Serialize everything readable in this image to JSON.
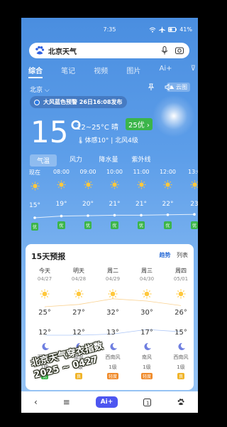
{
  "status": {
    "time": "7:35",
    "battery": "41%"
  },
  "search": {
    "query": "北京天气"
  },
  "tabs": [
    {
      "label": "综合",
      "active": true
    },
    {
      "label": "笔记"
    },
    {
      "label": "视频"
    },
    {
      "label": "图片"
    },
    {
      "label": "Ai+"
    },
    {
      "label": ""
    }
  ],
  "city": {
    "name": "北京",
    "cloud_label": "云图"
  },
  "alert": {
    "text": "大风蓝色预警 26日16:08发布"
  },
  "current": {
    "temp": "15°",
    "range": "12~25°C 晴",
    "aqi": "25优",
    "feel": "体感10° | 北风4级"
  },
  "subtabs": [
    "气温",
    "风力",
    "降水量",
    "紫外线"
  ],
  "hourly": [
    {
      "time": "现在",
      "temp": "15°",
      "q": "优",
      "v": 15
    },
    {
      "time": "08:00",
      "temp": "19°",
      "q": "优",
      "v": 19
    },
    {
      "time": "09:00",
      "temp": "20°",
      "q": "优",
      "v": 20
    },
    {
      "time": "10:00",
      "temp": "21°",
      "q": "优",
      "v": 21
    },
    {
      "time": "11:00",
      "temp": "21°",
      "q": "优",
      "v": 21
    },
    {
      "time": "12:00",
      "temp": "22°",
      "q": "优",
      "v": 22
    },
    {
      "time": "13:0",
      "temp": "23",
      "q": "优",
      "v": 23
    }
  ],
  "forecast": {
    "title": "15天预报",
    "toggle_trend": "趋势",
    "toggle_list": "列表",
    "days": [
      {
        "day": "今天",
        "date": "04/27",
        "hi": "25°",
        "lo": "12°",
        "wind": "西南风",
        "level": "1级",
        "q": "优",
        "qcolor": "#3bb54a",
        "hi_v": 25,
        "lo_v": 12
      },
      {
        "day": "明天",
        "date": "04/28",
        "hi": "27°",
        "lo": "12°",
        "wind": "南风",
        "level": "1级",
        "q": "良",
        "qcolor": "#f0b429",
        "hi_v": 27,
        "lo_v": 12
      },
      {
        "day": "周二",
        "date": "04/29",
        "hi": "32°",
        "lo": "13°",
        "wind": "西南风",
        "level": "1级",
        "q": "轻度",
        "qcolor": "#f08a29",
        "hi_v": 32,
        "lo_v": 13
      },
      {
        "day": "周三",
        "date": "04/30",
        "hi": "30°",
        "lo": "17°",
        "wind": "南风",
        "level": "1级",
        "q": "轻度",
        "qcolor": "#f08a29",
        "hi_v": 30,
        "lo_v": 17
      },
      {
        "day": "周四",
        "date": "05/01",
        "hi": "26°",
        "lo": "15°",
        "wind": "西南风",
        "level": "1级",
        "q": "良",
        "qcolor": "#f0b429",
        "hi_v": 26,
        "lo_v": 15
      }
    ]
  },
  "overlay": {
    "line1": "北京天气穿衣指数",
    "line2": "2025 ~ 0427"
  },
  "nav": {
    "ai": "Ai+"
  }
}
